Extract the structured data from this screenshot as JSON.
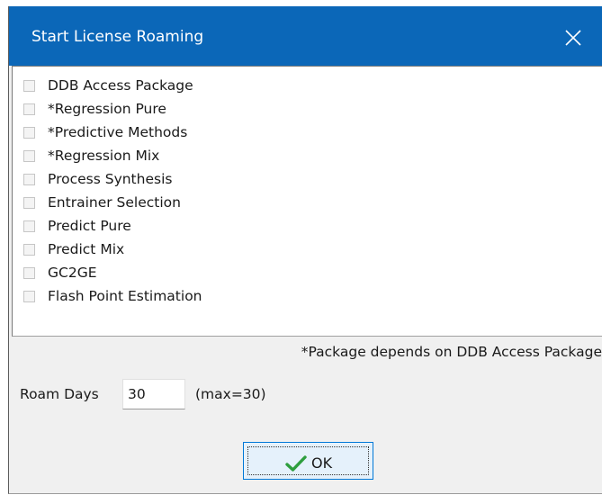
{
  "window": {
    "title": "Start License Roaming",
    "titlebar_color": "#0b67b8",
    "close_icon": "close-icon"
  },
  "packages": [
    {
      "label": "DDB Access Package",
      "checked": false
    },
    {
      "label": "*Regression Pure",
      "checked": false
    },
    {
      "label": "*Predictive Methods",
      "checked": false
    },
    {
      "label": "*Regression Mix",
      "checked": false
    },
    {
      "label": "Process Synthesis",
      "checked": false
    },
    {
      "label": "Entrainer Selection",
      "checked": false
    },
    {
      "label": "Predict Pure",
      "checked": false
    },
    {
      "label": "Predict Mix",
      "checked": false
    },
    {
      "label": "GC2GE",
      "checked": false
    },
    {
      "label": "Flash Point Estimation",
      "checked": false
    }
  ],
  "footnote": "*Package depends on DDB Access Package",
  "roam": {
    "label": "Roam Days",
    "value": "30",
    "max_note": "(max=30)"
  },
  "ok_button": {
    "label": "OK",
    "icon": "checkmark-icon",
    "icon_color": "#2e9e3e"
  }
}
